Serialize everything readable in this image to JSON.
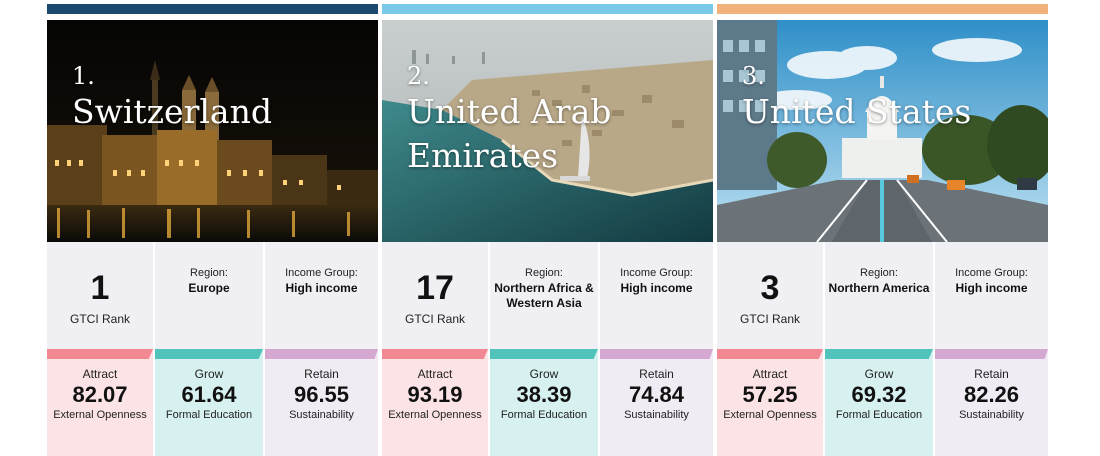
{
  "colors": {
    "switzerland_bar": "#1c4a6e",
    "uae_bar": "#79c9e8",
    "us_bar": "#f2b27c",
    "attract": "#f28891",
    "grow": "#52c3bb",
    "retain": "#d4a8d0"
  },
  "labels": {
    "gtci_rank": "GTCI Rank",
    "region": "Region:",
    "income_group": "Income Group:",
    "attract": "Attract",
    "grow": "Grow",
    "retain": "Retain",
    "attract_sub": "External Openness",
    "grow_sub": "Formal Education",
    "retain_sub": "Sustainability"
  },
  "countries": [
    {
      "position": "1.",
      "name": "Switzerland",
      "gtci_rank": "1",
      "region": "Europe",
      "income_group": "High income",
      "attract": "82.07",
      "grow": "61.64",
      "retain": "96.55",
      "photo": "night-city-waterfront"
    },
    {
      "position": "2.",
      "name": "United Arab Emirates",
      "gtci_rank": "17",
      "region": "Northern Africa & Western Asia",
      "income_group": "High income",
      "attract": "93.19",
      "grow": "38.39",
      "retain": "74.84",
      "photo": "aerial-coastline"
    },
    {
      "position": "3.",
      "name": "United States",
      "gtci_rank": "3",
      "region": "Northern America",
      "income_group": "High income",
      "attract": "57.25",
      "grow": "69.32",
      "retain": "82.26",
      "photo": "capitol-avenue"
    }
  ]
}
